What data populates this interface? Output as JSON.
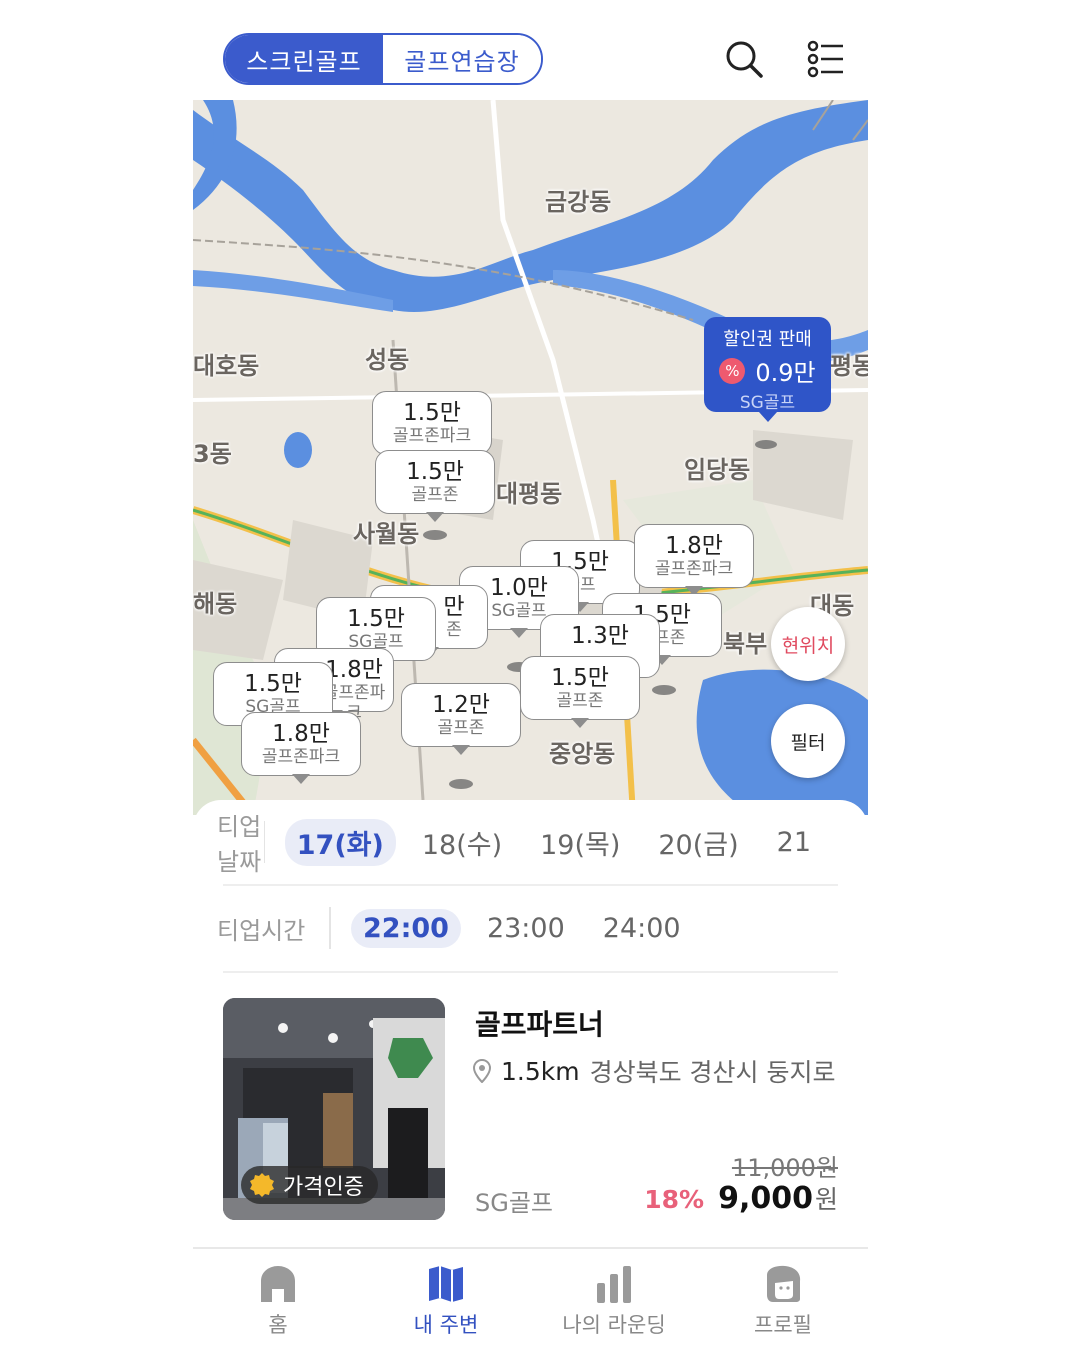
{
  "header": {
    "tabs": [
      {
        "label": "스크린골프",
        "active": true
      },
      {
        "label": "골프연습장",
        "active": false
      }
    ],
    "search_icon": "search-icon",
    "menu_icon": "list-icon"
  },
  "map": {
    "places": [
      "금강동",
      "성동",
      "임당동",
      "대평동",
      "사월동",
      "중앙동",
      "북부",
      "대동",
      "3동",
      "해동",
      "대호동",
      "평동"
    ],
    "promo": {
      "title": "할인권 판매",
      "badge": "%",
      "price": "0.9만",
      "name": "SG골프"
    },
    "pins": [
      {
        "price": "1.5만",
        "name": "골프존파크"
      },
      {
        "price": "1.5만",
        "name": "골프존"
      },
      {
        "price": "1.5만",
        "name": "골프"
      },
      {
        "price": "1.8만",
        "name": "골프존파크"
      },
      {
        "price": "1.0만",
        "name": "SG골프"
      },
      {
        "price": "1.5만",
        "name": "골프존"
      },
      {
        "price": "만",
        "name": "존"
      },
      {
        "price": "1.5만",
        "name": "SG골프"
      },
      {
        "price": "1.3만",
        "name": ""
      },
      {
        "price": "1.8만",
        "name": "골프존파크"
      },
      {
        "price": "1.5만",
        "name": "골프존"
      },
      {
        "price": "1.5만",
        "name": "SG골프"
      },
      {
        "price": "1.2만",
        "name": "골프존"
      },
      {
        "price": "1.8만",
        "name": "골프존파크"
      }
    ],
    "buttons": {
      "locate": "현위치",
      "filter": "필터"
    }
  },
  "filters": {
    "date_label": "티업날짜",
    "dates": [
      {
        "label": "17(화)",
        "selected": true
      },
      {
        "label": "18(수)",
        "selected": false
      },
      {
        "label": "19(목)",
        "selected": false
      },
      {
        "label": "20(금)",
        "selected": false
      },
      {
        "label": "21",
        "selected": false
      }
    ],
    "time_label": "티업시간",
    "times": [
      {
        "label": "22:00",
        "selected": true
      },
      {
        "label": "23:00",
        "selected": false
      },
      {
        "label": "24:00",
        "selected": false
      }
    ]
  },
  "listing": {
    "title": "골프파트너",
    "distance": "1.5km",
    "address": "경상북도 경산시 둥지로",
    "badge": "가격인증",
    "brand": "SG골프",
    "original_price": "11,000원",
    "discount": "18%",
    "price": "9,000",
    "currency": "원"
  },
  "nav": [
    {
      "label": "홈",
      "icon": "home-icon",
      "active": false
    },
    {
      "label": "내 주변",
      "icon": "map-icon",
      "active": true
    },
    {
      "label": "나의 라운딩",
      "icon": "bar-chart-icon",
      "active": false
    },
    {
      "label": "프로필",
      "icon": "profile-icon",
      "active": false
    }
  ],
  "colors": {
    "accent": "#3b5bcc",
    "discount": "#e8617a",
    "promo": "#2f55c8",
    "water": "#5b8fe0"
  }
}
